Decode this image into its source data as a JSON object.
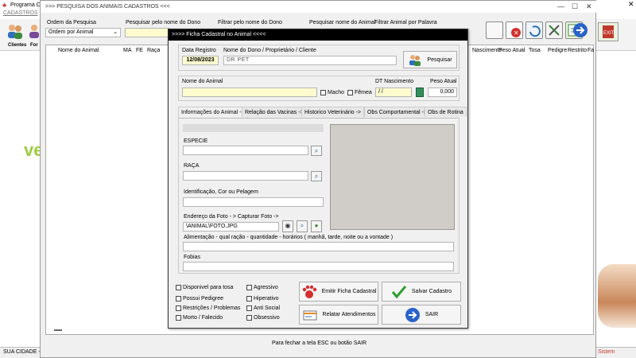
{
  "main": {
    "title": "Programa C",
    "menu_label": "CADASTROS",
    "toolbar": {
      "clientes_label": "Clientes",
      "fornecedores_label": "For"
    },
    "watermark_text": "ve",
    "status": {
      "city": "SUA CIDADE -",
      "system": "Sistem"
    }
  },
  "search_window": {
    "title": ">>>  PESQUISA DOS ANIMAIS CADASTROS  <<<",
    "order_label": "Ordem da Pesquisa",
    "order_select": "Ordem por Animal",
    "search_owner_label": "Pesquisar pelo nome do Dono",
    "filter_owner_label": "Filtrar pelo nome do Dono",
    "search_animal_name_label": "Pesquisar nome do Animal",
    "filter_keyword_label": "Filtrar Animal por Palavra",
    "columns_left": [
      "Nome do Animal",
      "MA",
      "FE",
      "Raça"
    ],
    "columns_right": [
      "Nascimento",
      "Peso Atual",
      "Tosa",
      "Pedigre",
      "Restrito",
      "Fa"
    ],
    "footer_hint": "Para fechar a tela ESC ou botão SAIR"
  },
  "dialog": {
    "title": ">>>>   Ficha Cadastral no Animal   <<<<",
    "date_label": "Data Registro",
    "date_value": "12/08/2023",
    "owner_label": "Nome do Dono / Proprietário / Cliente",
    "owner_value": "DR PET",
    "search_button": "Pesquisar",
    "animal_name_label": "Nome do Animal",
    "macho_label": "Macho",
    "femea_label": "Fêmea",
    "birth_label": "DT Nascimento",
    "birth_value": " /  /",
    "weight_label": "Peso Atual",
    "weight_value": "0,000",
    "tabs": [
      "Informações do Animal ->",
      "Relação das Vacinas ->",
      "Historico Veterinário ->",
      "Obs Comportamental ->",
      "Obs de Rotina"
    ],
    "especie_label": "ESPECIE",
    "raca_label": "RAÇA",
    "ident_label": "Identificação, Cor ou Pelagem",
    "photo_label": "Endereço da Foto - >   Capturar Foto  ->",
    "photo_value": "\\ANIMAL\\FOTO.JPG",
    "feeding_label": "Alimentação - qual ração - quantidade - horários ( manhã, tarde, noite ou a vontade )",
    "fobias_label": "Fobias",
    "checkboxes_left": [
      "Disponivel para tosa",
      "Possui Pedigree",
      "Restrições / Problemas",
      "Morto / Falecido"
    ],
    "checkboxes_right": [
      "Agressivo",
      "Hiperativo",
      "Anti Social",
      "Obsessivo"
    ],
    "btn_emit": "Emitir Ficha Cadastral",
    "btn_save": "Salvar Cadastro",
    "btn_report": "Relatar Atendimentos",
    "btn_exit": "SAIR"
  }
}
